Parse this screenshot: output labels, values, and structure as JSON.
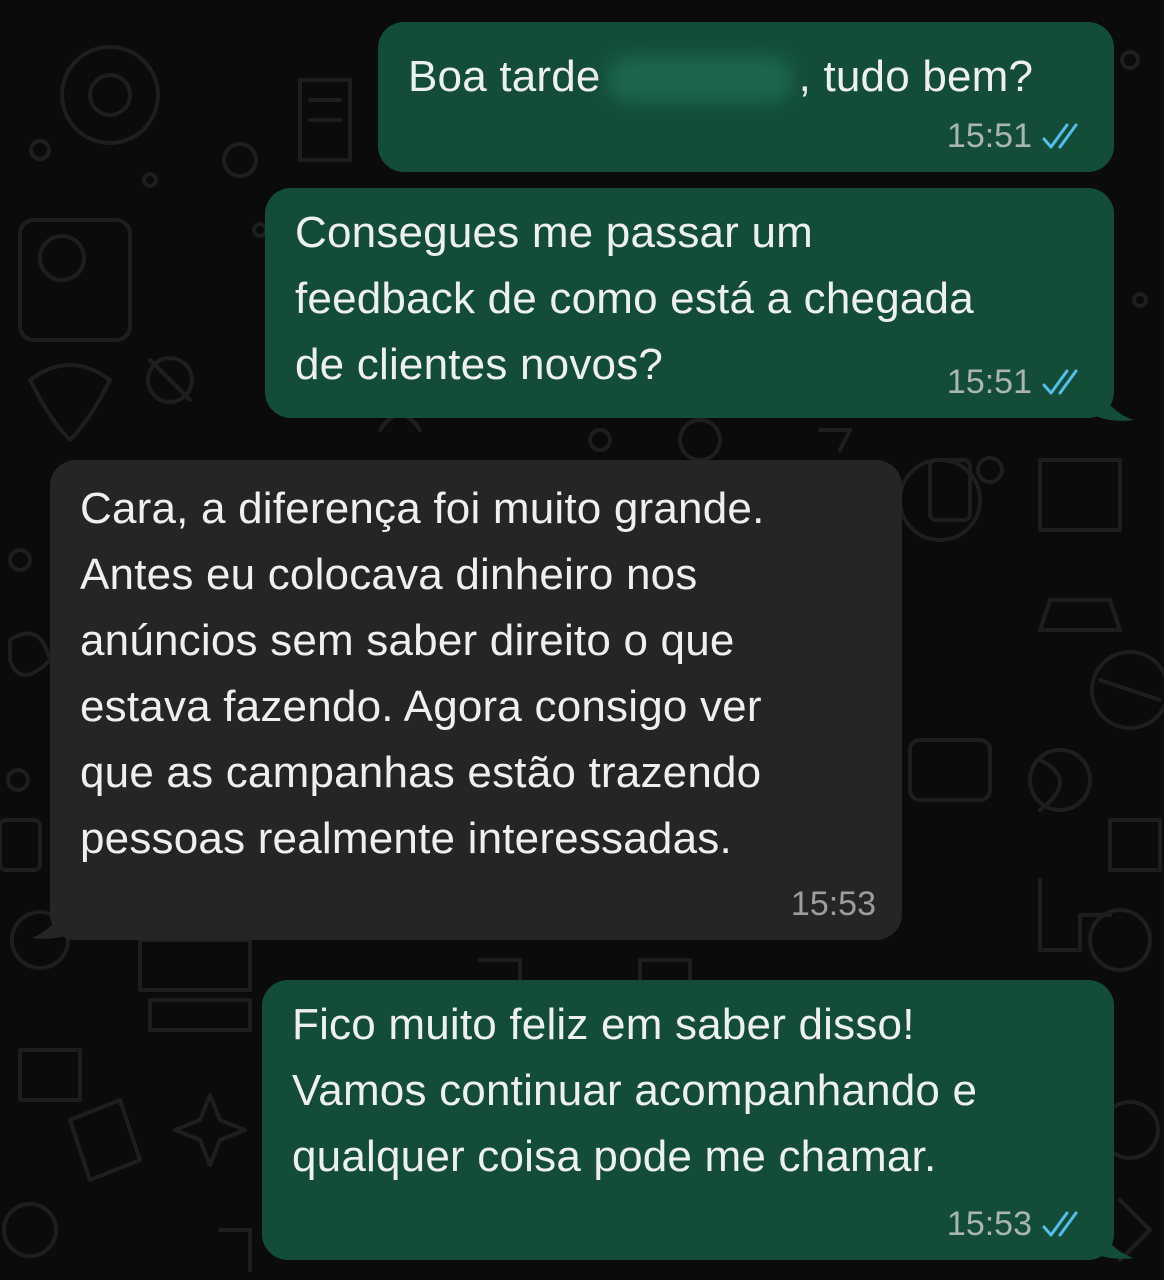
{
  "messages": [
    {
      "direction": "outgoing",
      "text_before_redaction": "Boa tarde",
      "text_after_redaction": ", tudo bem?",
      "time": "15:51",
      "status_icon": "double-check-read-icon"
    },
    {
      "direction": "outgoing",
      "text": "Consegues me passar um\nfeedback de como está a chegada\nde clientes novos?",
      "time": "15:51",
      "status_icon": "double-check-read-icon"
    },
    {
      "direction": "incoming",
      "text": "Cara, a diferença foi muito grande.\nAntes eu colocava dinheiro nos\nanúncios sem saber direito o que\nestava fazendo. Agora consigo ver\nque as campanhas estão trazendo\npessoas realmente interessadas.",
      "time": "15:53"
    },
    {
      "direction": "outgoing",
      "text": "Fico muito feliz em saber disso!\nVamos continuar acompanhando e\nqualquer coisa pode me chamar.",
      "time": "15:53",
      "status_icon": "double-check-read-icon"
    }
  ],
  "colors": {
    "background": "#0b0b0b",
    "outgoing_bubble": "#134d37",
    "incoming_bubble": "#242626",
    "read_ticks": "#53bdeb"
  }
}
